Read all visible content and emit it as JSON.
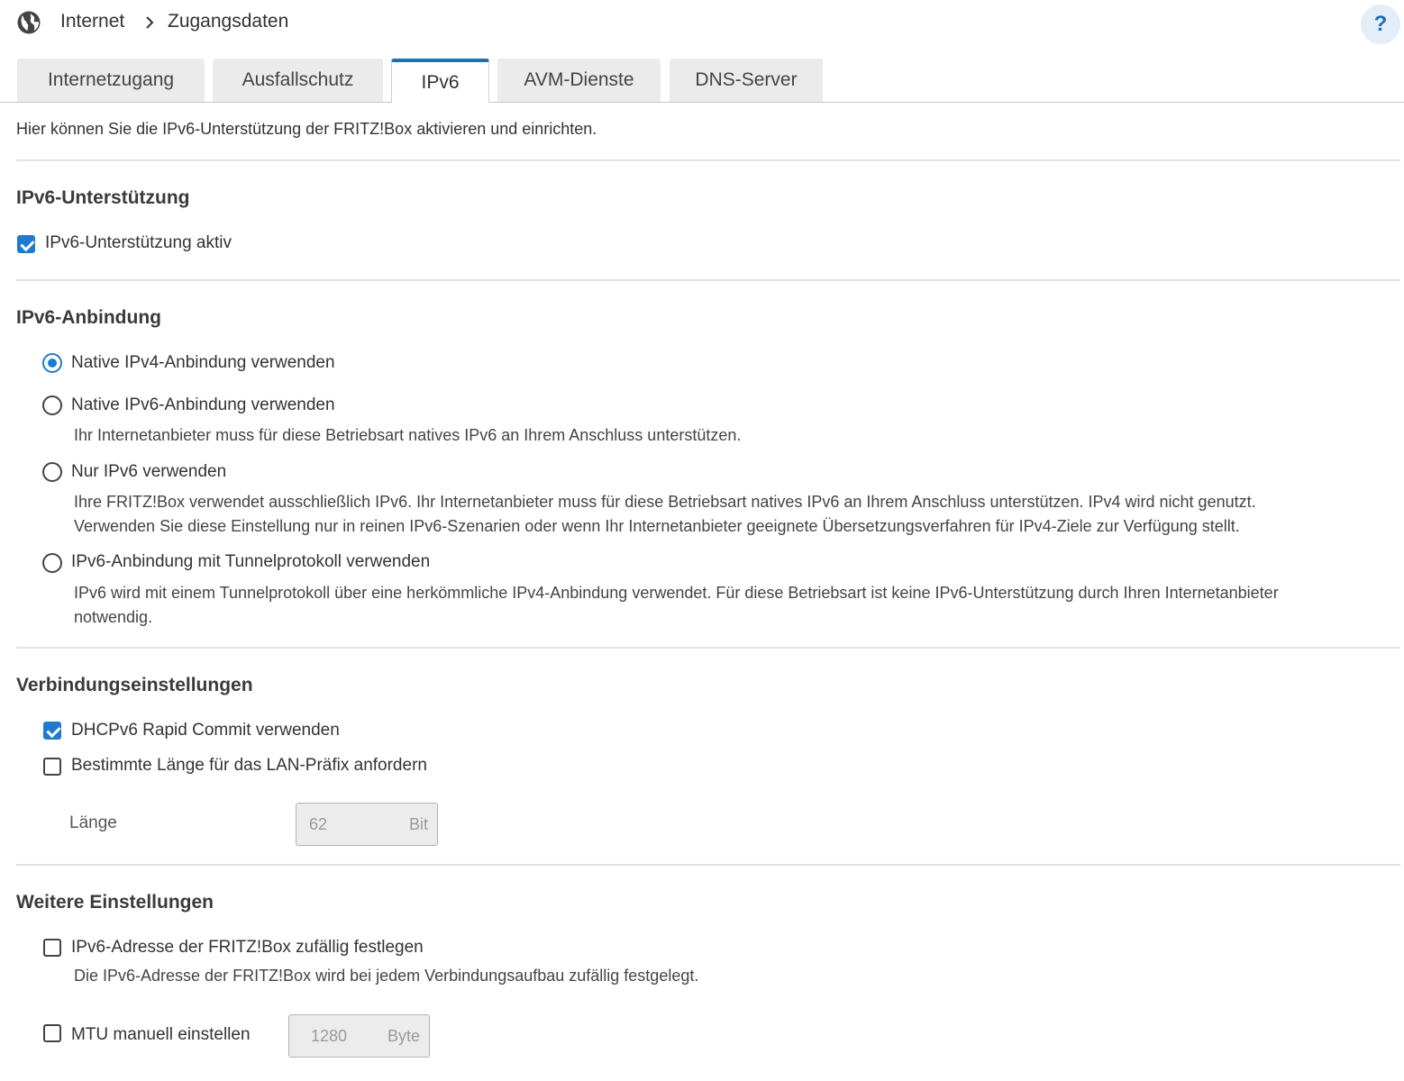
{
  "header": {
    "breadcrumb": [
      "Internet",
      "Zugangsdaten"
    ],
    "help_label": "?"
  },
  "tabs": [
    {
      "label": "Internetzugang",
      "active": false
    },
    {
      "label": "Ausfallschutz",
      "active": false
    },
    {
      "label": "IPv6",
      "active": true
    },
    {
      "label": "AVM-Dienste",
      "active": false
    },
    {
      "label": "DNS-Server",
      "active": false
    }
  ],
  "intro": "Hier können Sie die IPv6-Unterstützung der FRITZ!Box aktivieren und einrichten.",
  "support": {
    "heading": "IPv6-Unterstützung",
    "checkbox_label": "IPv6-Unterstützung aktiv",
    "checked": true
  },
  "binding": {
    "heading": "IPv6-Anbindung",
    "options": [
      {
        "label": "Native IPv4-Anbindung verwenden",
        "checked": true,
        "desc": []
      },
      {
        "label": "Native IPv6-Anbindung verwenden",
        "checked": false,
        "desc": [
          "Ihr Internetanbieter muss für diese Betriebsart natives IPv6 an Ihrem Anschluss unterstützen."
        ]
      },
      {
        "label": "Nur IPv6 verwenden",
        "checked": false,
        "desc": [
          "Ihre FRITZ!Box verwendet ausschließlich IPv6. Ihr Internetanbieter muss für diese Betriebsart natives IPv6 an Ihrem Anschluss unterstützen. IPv4 wird nicht genutzt.",
          "Verwenden Sie diese Einstellung nur in reinen IPv6-Szenarien oder wenn Ihr Internetanbieter geeignete Übersetzungsverfahren für IPv4-Ziele zur Verfügung stellt."
        ]
      },
      {
        "label": "IPv6-Anbindung mit Tunnelprotokoll verwenden",
        "checked": false,
        "desc": [
          "IPv6 wird mit einem Tunnelprotokoll über eine herkömmliche IPv4-Anbindung verwendet. Für diese Betriebsart ist keine IPv6-Unterstützung durch Ihren Internetanbieter",
          "notwendig."
        ]
      }
    ]
  },
  "connection": {
    "heading": "Verbindungseinstellungen",
    "rapid_commit": {
      "label": "DHCPv6 Rapid Commit verwenden",
      "checked": true
    },
    "prefix_length": {
      "label": "Bestimmte Länge für das LAN-Präfix anfordern",
      "checked": false
    },
    "length_label": "Länge",
    "length_value": "62",
    "length_unit": "Bit"
  },
  "further": {
    "heading": "Weitere Einstellungen",
    "random_address": {
      "label": "IPv6-Adresse der FRITZ!Box zufällig festlegen",
      "checked": false,
      "desc": "Die IPv6-Adresse der FRITZ!Box wird bei jedem Verbindungsaufbau zufällig festgelegt."
    },
    "mtu": {
      "label": "MTU manuell einstellen",
      "checked": false,
      "value": "1280",
      "unit": "Byte"
    }
  },
  "colors": {
    "accent": "#1e7bd0",
    "tab_active_border": "#1e6fb6",
    "help_bg": "#e3eef8"
  }
}
